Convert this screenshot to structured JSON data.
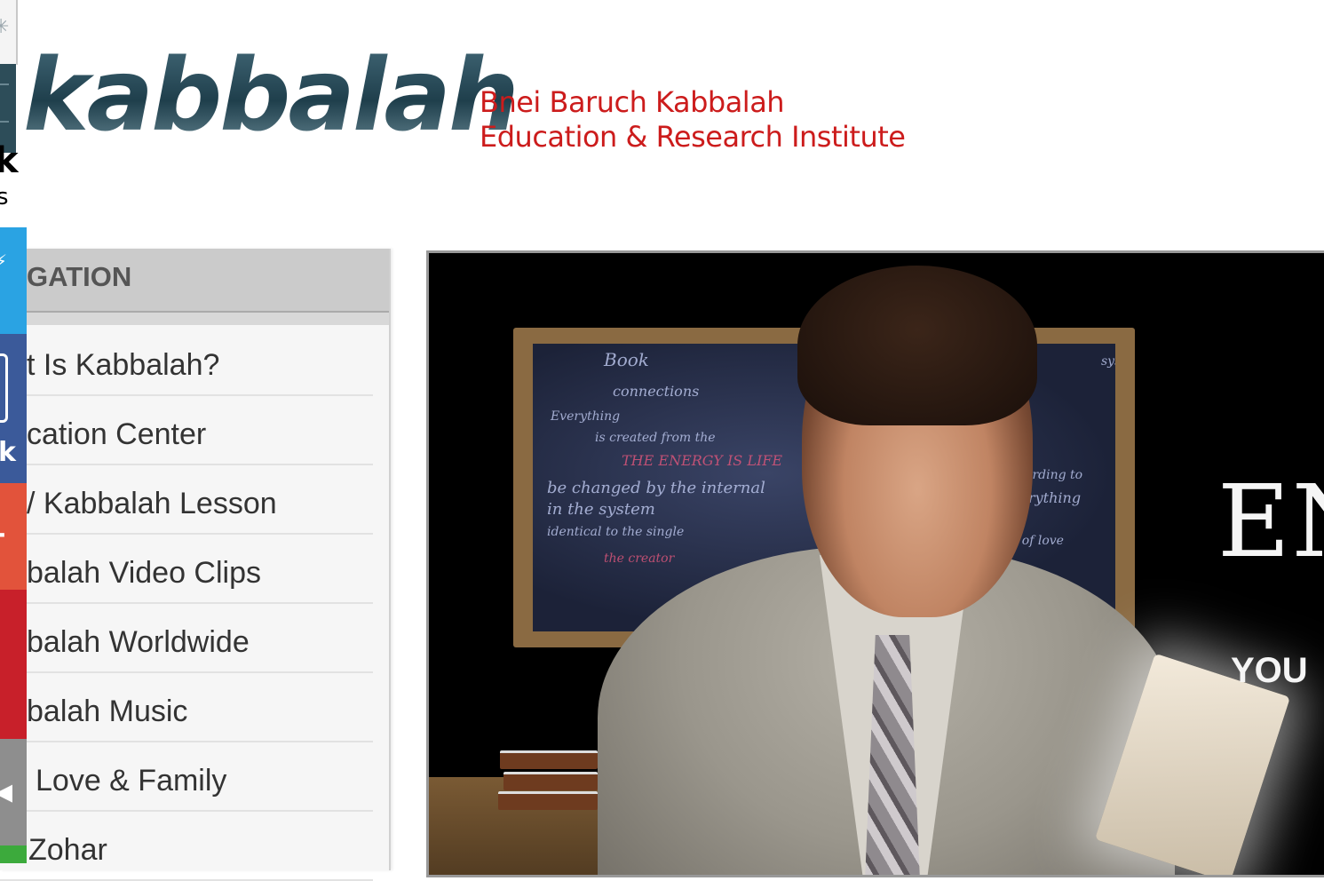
{
  "header": {
    "logo_word": "kabbalah",
    "org_line1": "Bnei Baruch Kabbalah",
    "org_line2": "Education & Research Institute",
    "clipped_big": "k",
    "clipped_small": "s"
  },
  "share_bar": {
    "buttons": [
      {
        "name": "twitter",
        "glyph": "⚡",
        "color": "#2aa3e3"
      },
      {
        "name": "facebook",
        "glyph": "k",
        "color": "#3b5a9a"
      },
      {
        "name": "google-plus",
        "glyph": "-",
        "color": "#e2533b"
      },
      {
        "name": "pinterest",
        "glyph": "",
        "color": "#c8202a"
      },
      {
        "name": "more",
        "glyph": "◂",
        "color": "#8e8e8e"
      },
      {
        "name": "sms",
        "glyph": "",
        "color": "#3caa3c"
      }
    ]
  },
  "navigation": {
    "title": "GATION",
    "items": [
      {
        "label": "t Is Kabbalah?"
      },
      {
        "label": "cation Center"
      },
      {
        "label": "/ Kabbalah Lesson"
      },
      {
        "label": "balah Video Clips"
      },
      {
        "label": "balah Worldwide"
      },
      {
        "label": "balah Music"
      },
      {
        "label": "Love & Family"
      },
      {
        "label": "Zohar"
      }
    ]
  },
  "video": {
    "overlay_big": "EN",
    "overlay_small": "YOU",
    "chalk": [
      "Book",
      "connections",
      "Everything",
      "is created from the",
      "THE ENERGY IS LIFE",
      "be changed by the internal",
      "in the system",
      "identical to the single",
      "the creator",
      "according to",
      "everything",
      "and of love",
      "system"
    ]
  },
  "colors": {
    "brand_dark": "#2a4c5a",
    "brand_red": "#cc1c1c",
    "nav_header_bg": "#cbcbcb",
    "nav_bg": "#f6f6f6"
  }
}
